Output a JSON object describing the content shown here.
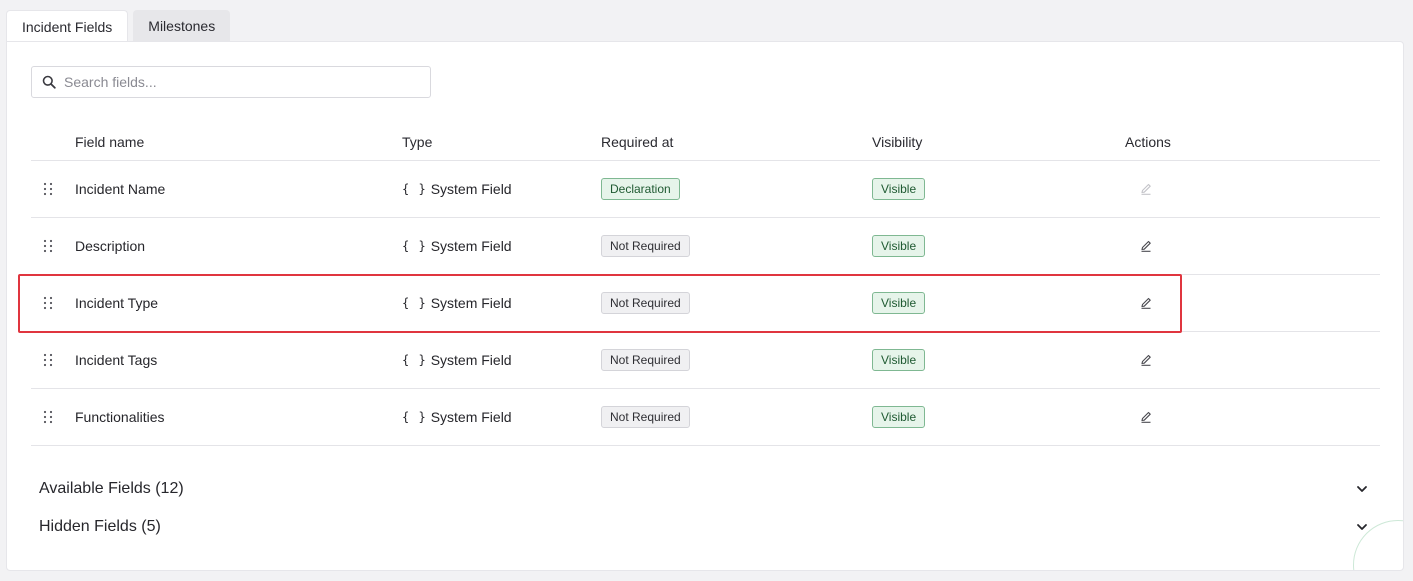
{
  "tabs": [
    {
      "label": "Incident Fields"
    },
    {
      "label": "Milestones"
    }
  ],
  "search": {
    "placeholder": "Search fields..."
  },
  "table": {
    "headers": {
      "field_name": "Field name",
      "type": "Type",
      "required_at": "Required at",
      "visibility": "Visibility",
      "actions": "Actions"
    },
    "rows": [
      {
        "name": "Incident Name",
        "type_icon": "{ }",
        "type": "System Field",
        "required": "Declaration",
        "required_color": "green",
        "visibility": "Visible",
        "edit_enabled": false
      },
      {
        "name": "Description",
        "type_icon": "{ }",
        "type": "System Field",
        "required": "Not Required",
        "required_color": "gray",
        "visibility": "Visible",
        "edit_enabled": true
      },
      {
        "name": "Incident Type",
        "type_icon": "{ }",
        "type": "System Field",
        "required": "Not Required",
        "required_color": "gray",
        "visibility": "Visible",
        "edit_enabled": true
      },
      {
        "name": "Incident Tags",
        "type_icon": "{ }",
        "type": "System Field",
        "required": "Not Required",
        "required_color": "gray",
        "visibility": "Visible",
        "edit_enabled": true
      },
      {
        "name": "Functionalities",
        "type_icon": "{ }",
        "type": "System Field",
        "required": "Not Required",
        "required_color": "gray",
        "visibility": "Visible",
        "edit_enabled": true
      }
    ]
  },
  "sections": {
    "available": {
      "label": "Available Fields (12)"
    },
    "hidden": {
      "label": "Hidden Fields (5)"
    }
  },
  "icons": {
    "search": "search-icon",
    "drag": "drag-handle-icon",
    "edit": "pencil-icon",
    "chevron": "chevron-down-icon"
  },
  "colors": {
    "highlight": "#e0353f",
    "badge_green_bg": "#e6f4ea",
    "badge_green_border": "#7fb892"
  }
}
